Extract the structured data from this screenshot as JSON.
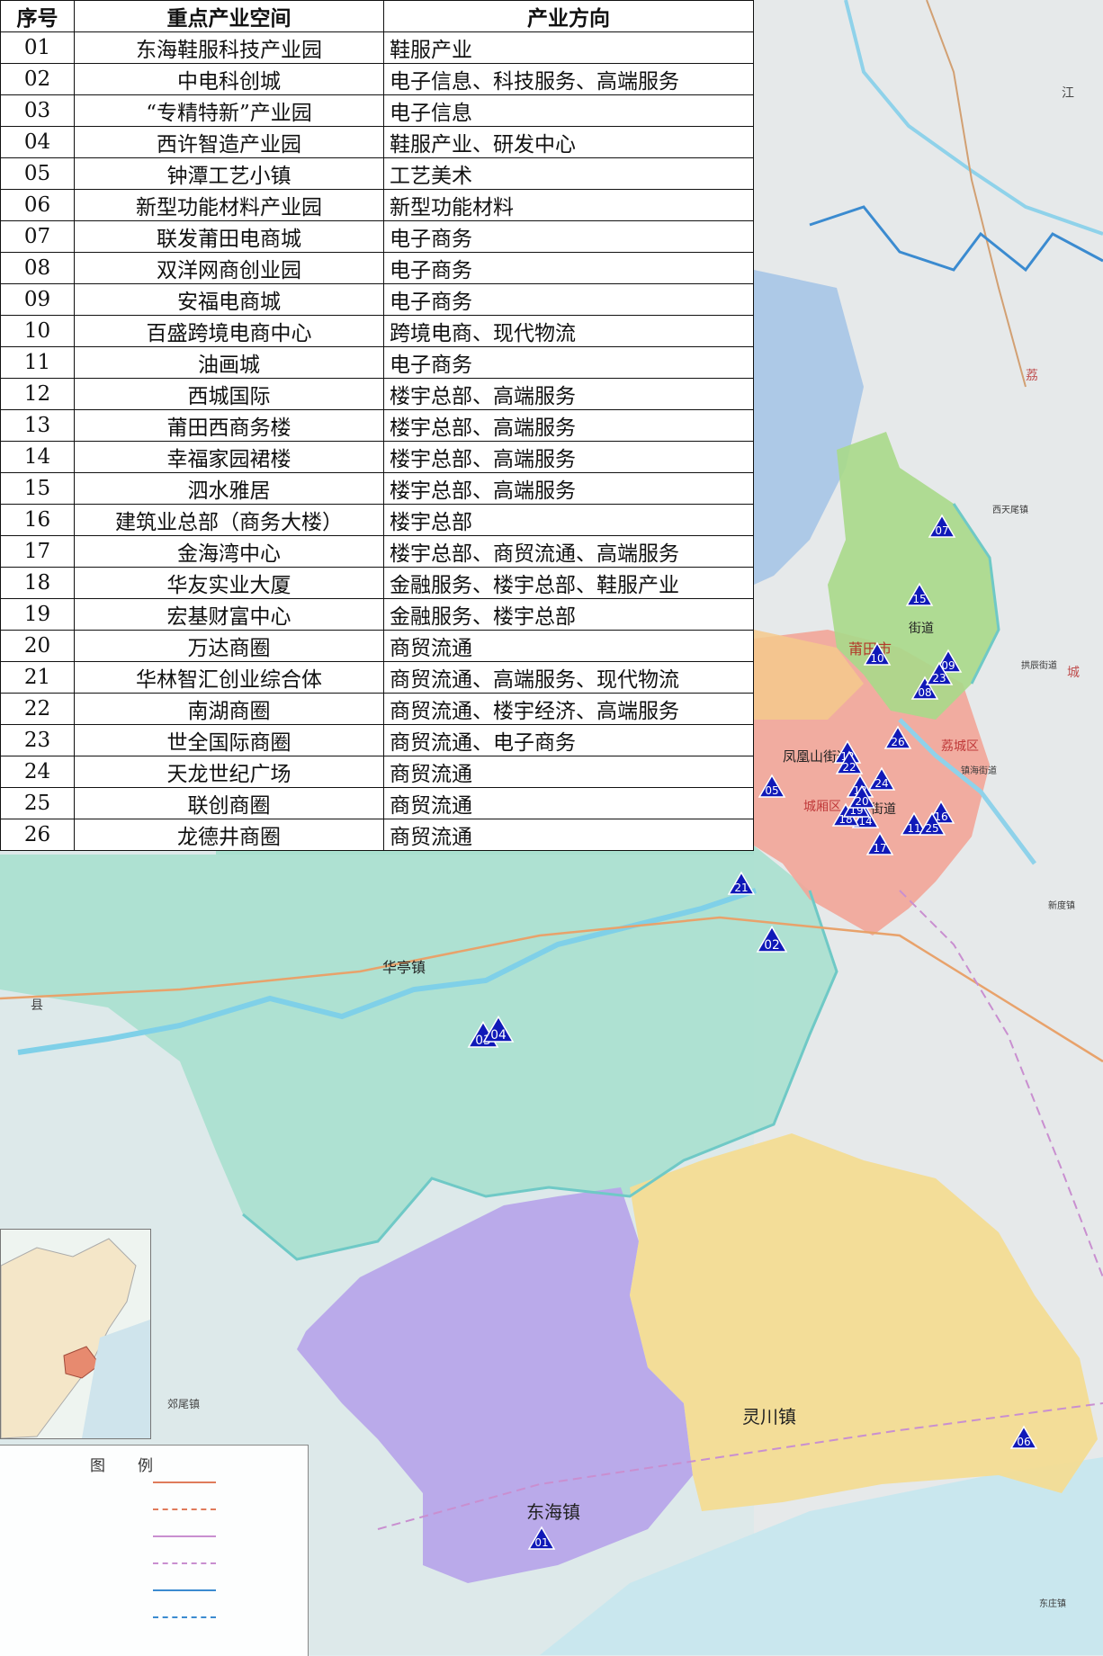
{
  "table": {
    "headers": [
      "序号",
      "重点产业空间",
      "产业方向"
    ],
    "rows": [
      {
        "no": "01",
        "name": "东海鞋服科技产业园",
        "direction": "鞋服产业"
      },
      {
        "no": "02",
        "name": "中电科创城",
        "direction": "电子信息、科技服务、高端服务"
      },
      {
        "no": "03",
        "name": "“专精特新”产业园",
        "direction": "电子信息"
      },
      {
        "no": "04",
        "name": "西许智造产业园",
        "direction": "鞋服产业、研发中心"
      },
      {
        "no": "05",
        "name": "钟潭工艺小镇",
        "direction": "工艺美术"
      },
      {
        "no": "06",
        "name": "新型功能材料产业园",
        "direction": "新型功能材料"
      },
      {
        "no": "07",
        "name": "联发莆田电商城",
        "direction": "电子商务"
      },
      {
        "no": "08",
        "name": "双洋网商创业园",
        "direction": "电子商务"
      },
      {
        "no": "09",
        "name": "安福电商城",
        "direction": "电子商务"
      },
      {
        "no": "10",
        "name": "百盛跨境电商中心",
        "direction": "跨境电商、现代物流"
      },
      {
        "no": "11",
        "name": "油画城",
        "direction": "电子商务"
      },
      {
        "no": "12",
        "name": "西城国际",
        "direction": "楼宇总部、高端服务"
      },
      {
        "no": "13",
        "name": "莆田西商务楼",
        "direction": "楼宇总部、高端服务"
      },
      {
        "no": "14",
        "name": "幸福家园裙楼",
        "direction": "楼宇总部、高端服务"
      },
      {
        "no": "15",
        "name": "泗水雅居",
        "direction": "楼宇总部、高端服务"
      },
      {
        "no": "16",
        "name": "建筑业总部（商务大楼）",
        "direction": "楼宇总部"
      },
      {
        "no": "17",
        "name": "金海湾中心",
        "direction": "楼宇总部、商贸流通、高端服务"
      },
      {
        "no": "18",
        "name": "华友实业大厦",
        "direction": "金融服务、楼宇总部、鞋服产业"
      },
      {
        "no": "19",
        "name": "宏基财富中心",
        "direction": "金融服务、楼宇总部"
      },
      {
        "no": "20",
        "name": "万达商圈",
        "direction": "商贸流通"
      },
      {
        "no": "21",
        "name": "华林智汇创业综合体",
        "direction": "商贸流通、高端服务、现代物流"
      },
      {
        "no": "22",
        "name": "南湖商圈",
        "direction": "商贸流通、楼宇经济、高端服务"
      },
      {
        "no": "23",
        "name": "世全国际商圈",
        "direction": "商贸流通、电子商务"
      },
      {
        "no": "24",
        "name": "天龙世纪广场",
        "direction": "商贸流通"
      },
      {
        "no": "25",
        "name": "联创商圈",
        "direction": "商贸流通"
      },
      {
        "no": "26",
        "name": "龙德井商圈",
        "direction": "商贸流通"
      }
    ]
  },
  "place_labels": [
    {
      "id": "huating",
      "text": "华亭镇"
    },
    {
      "id": "donghai",
      "text": "东海镇"
    },
    {
      "id": "lingchuan",
      "text": "灵川镇"
    },
    {
      "id": "putian",
      "text": "莆田市"
    },
    {
      "id": "fenghuangshan",
      "text": "凤凰山街道"
    },
    {
      "id": "chengxiang",
      "text": "城厢区"
    },
    {
      "id": "licheng",
      "text": "荔城区"
    },
    {
      "id": "jiedao-a",
      "text": "街道"
    },
    {
      "id": "jiedao-b",
      "text": "街道"
    },
    {
      "id": "xian",
      "text": "县"
    },
    {
      "id": "jiang",
      "text": "江"
    },
    {
      "id": "li",
      "text": "荔"
    },
    {
      "id": "cheng",
      "text": "城"
    },
    {
      "id": "xitianwei",
      "text": "西天尾镇"
    },
    {
      "id": "gongchen",
      "text": "拱辰街道"
    },
    {
      "id": "zhenhai",
      "text": "镇海街道"
    },
    {
      "id": "xindu",
      "text": "新度镇"
    },
    {
      "id": "jiaowei",
      "text": "郊尾镇"
    },
    {
      "id": "dongzhuang",
      "text": "东庄镇"
    }
  ],
  "markers": [
    {
      "no": "01"
    },
    {
      "no": "02"
    },
    {
      "no": "03"
    },
    {
      "no": "04"
    },
    {
      "no": "05"
    },
    {
      "no": "06"
    },
    {
      "no": "07"
    },
    {
      "no": "08"
    },
    {
      "no": "09"
    },
    {
      "no": "10"
    },
    {
      "no": "11"
    },
    {
      "no": "12"
    },
    {
      "no": "13"
    },
    {
      "no": "14"
    },
    {
      "no": "15"
    },
    {
      "no": "16"
    },
    {
      "no": "17"
    },
    {
      "no": "18"
    },
    {
      "no": "19"
    },
    {
      "no": "20"
    },
    {
      "no": "21"
    },
    {
      "no": "22"
    },
    {
      "no": "23"
    },
    {
      "no": "24"
    },
    {
      "no": "25"
    },
    {
      "no": "26"
    }
  ],
  "legend": {
    "title": "图例"
  },
  "colors": {
    "marker": "#1019b8",
    "district_green": "#a8d98a",
    "district_red": "#f2a598",
    "district_orange": "#f5c98c",
    "district_purple": "#b7a6ea",
    "district_yellow": "#f3dc94",
    "district_teal": "#a9e0cf"
  }
}
